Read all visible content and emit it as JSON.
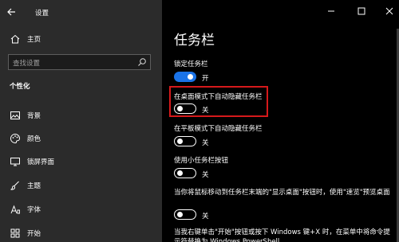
{
  "window": {
    "title": "设置"
  },
  "sidebar": {
    "home_label": "主页",
    "search_placeholder": "查找设置",
    "section_heading": "个性化",
    "items": [
      {
        "label": "背景",
        "icon": "image-icon"
      },
      {
        "label": "颜色",
        "icon": "palette-icon"
      },
      {
        "label": "锁屏界面",
        "icon": "monitor-icon"
      },
      {
        "label": "主题",
        "icon": "brush-icon"
      },
      {
        "label": "字体",
        "icon": "font-icon"
      },
      {
        "label": "开始",
        "icon": "start-grid-icon"
      }
    ]
  },
  "main": {
    "title": "任务栏",
    "settings": [
      {
        "label": "锁定任务栏",
        "state": "开",
        "on": true
      },
      {
        "label": "在桌面模式下自动隐藏任务栏",
        "state": "关",
        "on": false,
        "highlighted": true
      },
      {
        "label": "在平板模式下自动隐藏任务栏",
        "state": "关",
        "on": false
      },
      {
        "label": "使用小任务栏按钮",
        "state": "关",
        "on": false
      },
      {
        "label": "当你将鼠标移动到任务栏末端的\"显示桌面\"按钮时，使用\"速览\"预览桌面",
        "state": "关",
        "on": false
      },
      {
        "label": "当我右键单击\"开始\"按钮或按下 Windows 键+X 时，在菜单中将命令提示符替换为 Windows PowerShell",
        "state": "",
        "on": false
      }
    ]
  },
  "colors": {
    "accent": "#1a73e8",
    "highlight_border": "#d6191b",
    "sidebar_bg": "#2b2b2b",
    "main_bg": "#000000"
  }
}
